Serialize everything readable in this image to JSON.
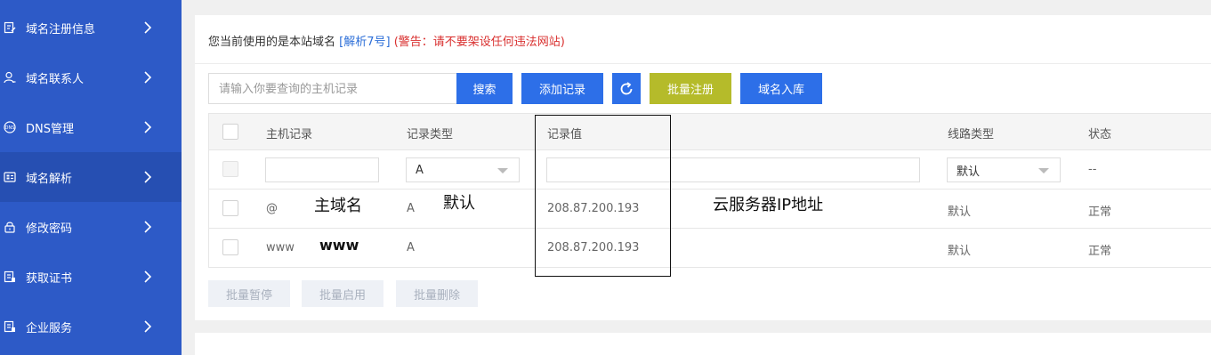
{
  "sidebar": {
    "items": [
      {
        "label": "域名注册信息",
        "icon": "register-icon"
      },
      {
        "label": "域名联系人",
        "icon": "contact-icon"
      },
      {
        "label": "DNS管理",
        "icon": "dns-icon"
      },
      {
        "label": "域名解析",
        "icon": "resolve-icon",
        "active": true
      },
      {
        "label": "修改密码",
        "icon": "lock-icon"
      },
      {
        "label": "获取证书",
        "icon": "certificate-icon"
      },
      {
        "label": "企业服务",
        "icon": "service-icon"
      }
    ]
  },
  "notice": {
    "prefix": "您当前使用的是本站域名 ",
    "link": "[解析7号]",
    "warning": " (警告：请不要架设任何违法网站)"
  },
  "toolbar": {
    "search_placeholder": "请输入你要查询的主机记录",
    "search_label": "搜索",
    "add_label": "添加记录",
    "refresh_icon": "refresh-icon",
    "batch_register_label": "批量注册",
    "domain_import_label": "域名入库"
  },
  "table": {
    "headers": [
      "主机记录",
      "记录类型",
      "记录值",
      "线路类型",
      "状态"
    ],
    "new_row": {
      "type": "A",
      "line": "默认",
      "status": "--"
    },
    "rows": [
      {
        "host": "@",
        "type": "A",
        "value": "208.87.200.193",
        "line": "默认",
        "status": "正常"
      },
      {
        "host": "www",
        "type": "A",
        "value": "208.87.200.193",
        "line": "默认",
        "status": "正常"
      }
    ]
  },
  "annotations": {
    "main_domain": "主域名",
    "default": "默认",
    "ip": "云服务器IP地址",
    "www": "www"
  },
  "batch": {
    "pause_label": "批量暂停",
    "enable_label": "批量启用",
    "delete_label": "批量删除"
  },
  "colors": {
    "sidebar_bg": "#2d5ac7",
    "primary_button": "#2d6fe8",
    "olive_button": "#b5bb2a",
    "warning_red": "#d9302f",
    "link_blue": "#2d6fd8"
  }
}
